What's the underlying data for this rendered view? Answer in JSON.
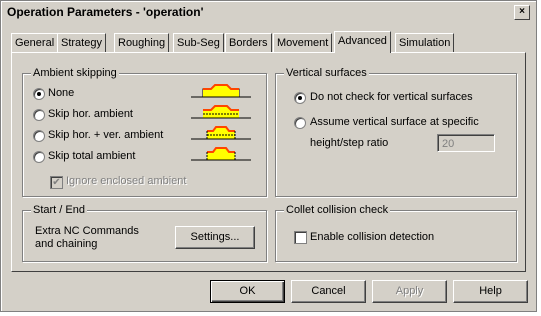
{
  "window": {
    "title": "Operation Parameters - 'operation'",
    "close_glyph": "×"
  },
  "tabs": [
    {
      "label": "General"
    },
    {
      "label": "Strategy"
    },
    {
      "label": "Roughing"
    },
    {
      "label": "Sub-Seg"
    },
    {
      "label": "Borders"
    },
    {
      "label": "Movement"
    },
    {
      "label": "Advanced",
      "active": true
    },
    {
      "label": "Simulation"
    }
  ],
  "ambient": {
    "title": "Ambient skipping",
    "options": [
      {
        "label": "None",
        "checked": true
      },
      {
        "label": "Skip hor. ambient",
        "checked": false
      },
      {
        "label": "Skip hor. + ver. ambient",
        "checked": false
      },
      {
        "label": "Skip total ambient",
        "checked": false
      }
    ],
    "ignore_enclosed": {
      "label": "Ignore enclosed ambient",
      "checked": true,
      "enabled": false
    }
  },
  "vertical": {
    "title": "Vertical surfaces",
    "options": [
      {
        "label": "Do not check for vertical surfaces",
        "checked": true
      },
      {
        "label": "Assume vertical surface at specific",
        "checked": false
      }
    ],
    "ratio_label": "height/step ratio",
    "ratio_value": "20"
  },
  "startend": {
    "title": "Start / End",
    "text1": "Extra NC Commands",
    "text2": "and chaining",
    "settings_label": "Settings..."
  },
  "collet": {
    "title": "Collet collision check",
    "enable_label": "Enable collision detection",
    "checked": false
  },
  "buttons": {
    "ok": "OK",
    "cancel": "Cancel",
    "apply": "Apply",
    "help": "Help"
  },
  "colors": {
    "fill": "#ffff00",
    "top": "#ff4500",
    "line": "#000000"
  }
}
